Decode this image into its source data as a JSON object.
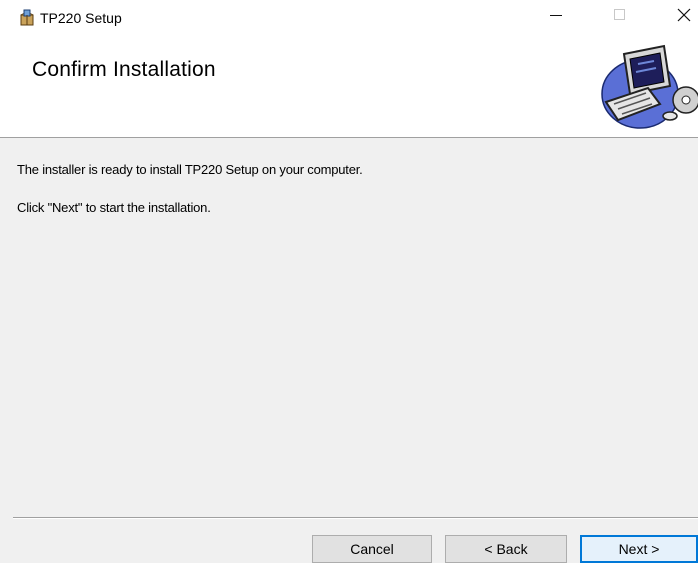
{
  "window": {
    "title": "TP220 Setup",
    "icon": "installer-box-icon",
    "controls": {
      "minimize": "minimize-icon",
      "maximize": "maximize-icon",
      "close": "close-icon"
    }
  },
  "header": {
    "title": "Confirm Installation",
    "art": "computer-illustration-icon"
  },
  "body": {
    "line1": "The installer is ready to install TP220 Setup on your computer.",
    "line2": "Click \"Next\" to start the installation."
  },
  "buttons": {
    "cancel": "Cancel",
    "back": "< Back",
    "next": "Next >"
  },
  "colors": {
    "accent": "#0078d7",
    "window_bg": "#f0f0f0",
    "header_bg": "#ffffff"
  }
}
